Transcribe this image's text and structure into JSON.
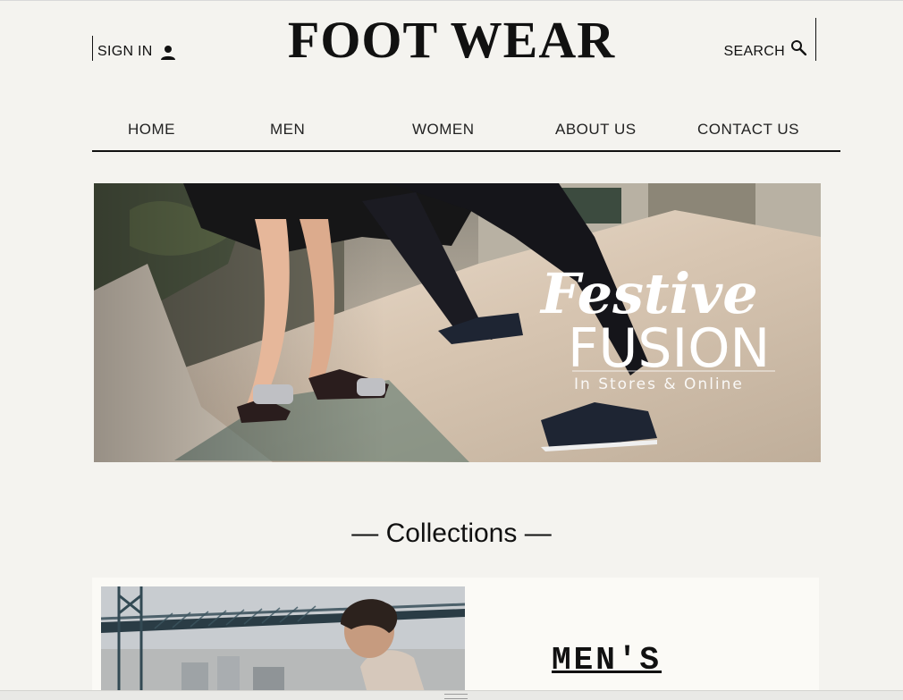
{
  "header": {
    "sign_in": "SIGN IN",
    "logo": "FOOT WEAR",
    "search": "SEARCH"
  },
  "nav": {
    "items": [
      "HOME",
      "MEN",
      "WOMEN",
      "ABOUT US",
      "CONTACT US"
    ]
  },
  "banner": {
    "script_text": "Festive",
    "headline": "FUSION",
    "tagline": "In Stores & Online"
  },
  "collections": {
    "title": "— Collections —",
    "mens_heading": "MEN'S"
  },
  "icons": {
    "sign_in_icon": "person-icon",
    "search_icon": "search-icon"
  },
  "colors": {
    "background": "#f4f3ef",
    "text": "#111111",
    "card_background": "#fbfaf6"
  }
}
